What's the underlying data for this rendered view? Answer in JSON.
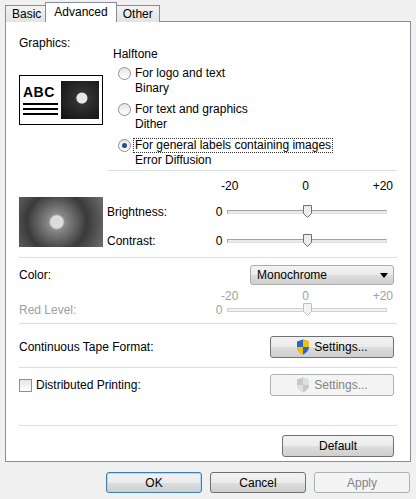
{
  "tabs": [
    {
      "label": "Basic",
      "selected": false
    },
    {
      "label": "Advanced",
      "selected": true
    },
    {
      "label": "Other",
      "selected": false
    }
  ],
  "graphics": {
    "label": "Graphics:",
    "preview_text": "ABC",
    "halftone": {
      "label": "Halftone",
      "options": [
        {
          "label": "For logo and text",
          "sublabel": "Binary",
          "selected": false
        },
        {
          "label": "For text and graphics",
          "sublabel": "Dither",
          "selected": false
        },
        {
          "label": "For general labels containing images",
          "sublabel": "Error Diffusion",
          "selected": true
        }
      ]
    }
  },
  "adjustments": {
    "scale": [
      "-20",
      "0",
      "+20"
    ],
    "sliders": [
      {
        "label": "Brightness:",
        "value": "0",
        "level": 0.5
      },
      {
        "label": "Contrast:",
        "value": "0",
        "level": 0.5
      }
    ]
  },
  "color": {
    "label": "Color:",
    "value": "Monochrome"
  },
  "red_level": {
    "label": "Red Level:",
    "disabled": true,
    "scale": [
      "-20",
      "0",
      "+20"
    ],
    "value": "0",
    "level": 0.5
  },
  "continuous_tape_format": {
    "label": "Continuous Tape Format:",
    "button": {
      "label": "Settings...",
      "disabled": false
    }
  },
  "distributed_printing": {
    "label": "Distributed Printing:",
    "checked": false,
    "button": {
      "label": "Settings...",
      "disabled": true
    }
  },
  "default_button": {
    "label": "Default"
  },
  "buttons": [
    {
      "label": "OK",
      "default": true,
      "disabled": false
    },
    {
      "label": "Cancel",
      "default": false,
      "disabled": false
    },
    {
      "label": "Apply",
      "default": false,
      "disabled": true
    }
  ]
}
